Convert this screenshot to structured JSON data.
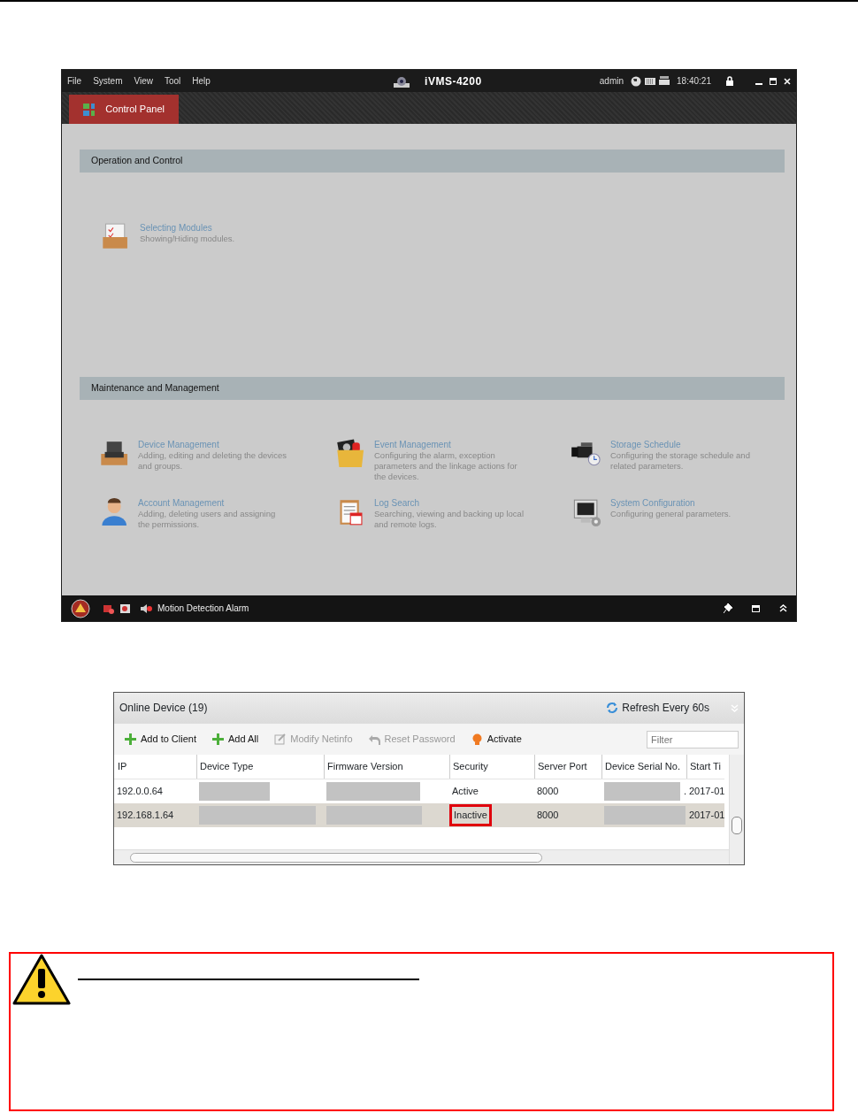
{
  "app_window": {
    "menu": [
      "File",
      "System",
      "View",
      "Tool",
      "Help"
    ],
    "title": "iVMS-4200",
    "user": "admin",
    "clock": "18:40:21",
    "tabs": [
      {
        "label": "Control Panel",
        "selected": true
      }
    ],
    "sections": [
      {
        "title": "Operation and Control",
        "modules": [
          {
            "kind": "modules",
            "title": "Selecting Modules",
            "description": "Showing/Hiding modules."
          }
        ]
      },
      {
        "title": "Maintenance and Management",
        "modules": [
          {
            "kind": "device",
            "title": "Device Management",
            "description": "Adding, editing and deleting the devices and groups."
          },
          {
            "kind": "event",
            "title": "Event Management",
            "description": "Configuring the alarm, exception parameters and the linkage actions for the devices."
          },
          {
            "kind": "storage",
            "title": "Storage Schedule",
            "description": "Configuring the storage schedule and related parameters."
          },
          {
            "kind": "account",
            "title": "Account Management",
            "description": "Adding, deleting users and assigning the permissions."
          },
          {
            "kind": "log",
            "title": "Log Search",
            "description": "Searching, viewing and backing up local and remote logs."
          },
          {
            "kind": "config",
            "title": "System Configuration",
            "description": "Configuring general parameters."
          }
        ]
      }
    ],
    "status_bar": {
      "alarm": "Motion Detection Alarm"
    }
  },
  "device_panel": {
    "title": "Online Device (19)",
    "refresh": "Refresh Every 60s",
    "toolbar": [
      {
        "kind": "add",
        "label": "Add to Client",
        "disabled": false
      },
      {
        "kind": "add",
        "label": "Add All",
        "disabled": false
      },
      {
        "kind": "edit",
        "label": "Modify Netinfo",
        "disabled": true
      },
      {
        "kind": "reset",
        "label": "Reset Password",
        "disabled": true
      },
      {
        "kind": "activate",
        "label": "Activate",
        "disabled": false
      }
    ],
    "filter": {
      "placeholder": "Filter"
    },
    "columns": [
      "IP",
      "Device Type",
      "Firmware Version",
      "Security",
      "Server Port",
      "Device Serial No.",
      "Start Ti"
    ],
    "rows": [
      {
        "ip": "192.0.0.64",
        "security": "Active",
        "port": "8000",
        "serial": ".",
        "start": "2017-01",
        "selected": false,
        "highlighted": false
      },
      {
        "ip": "192.168.1.64",
        "security": "Inactive",
        "port": "8000",
        "start": "2017-01",
        "selected": true,
        "highlighted": true
      }
    ]
  }
}
